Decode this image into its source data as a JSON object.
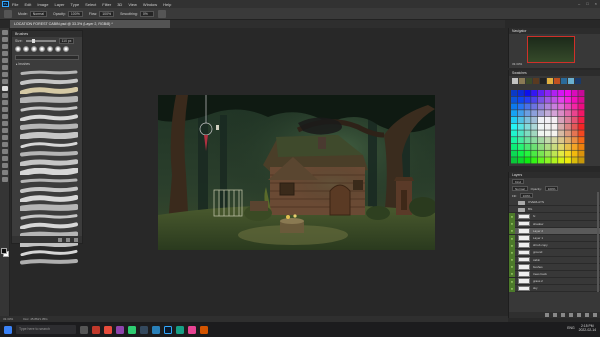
{
  "menubar": {
    "logo": "Ps",
    "items": [
      "File",
      "Edit",
      "Image",
      "Layer",
      "Type",
      "Select",
      "Filter",
      "3D",
      "View",
      "Window",
      "Help"
    ],
    "window_controls": [
      "–",
      "□",
      "×"
    ]
  },
  "options": {
    "mode_label": "Mode:",
    "mode_value": "Normal",
    "opacity_label": "Opacity:",
    "opacity_value": "100%",
    "flow_label": "Flow:",
    "flow_value": "100%",
    "smoothing_label": "Smoothing:",
    "smoothing_value": "0%"
  },
  "document": {
    "tab_title": "LOCATION FOREST CABIN.psd @ 33.3% (Layer 2, RGB/8) *"
  },
  "brushes_panel": {
    "title": "Brushes",
    "size_label": "Size:",
    "size_value": "110 px",
    "folder_name": "▸ brushes"
  },
  "navigator": {
    "title": "Navigator",
    "zoom": "33.33%"
  },
  "swatches": {
    "title": "Swatches",
    "colors": [
      "#c3c3c3",
      "#8a7a55",
      "#3c4a2a",
      "#5a3a20",
      "#222222",
      "#e2b040",
      "#c05020",
      "#2a6a9a",
      "#6ab0d0",
      "#1a3a6a"
    ]
  },
  "layers_panel": {
    "title": "Layers",
    "kind_label": "Kind",
    "blend_value": "Normal",
    "opacity_label": "Opacity:",
    "opacity_value": "100%",
    "fill_label": "Fill:",
    "fill_value": "100%",
    "layers": [
      {
        "name": "OVERLAYS",
        "type": "folder",
        "visible": false,
        "selected": false
      },
      {
        "name": "BG",
        "type": "folder",
        "visible": false,
        "selected": false
      },
      {
        "name": "fx",
        "type": "layer",
        "visible": true,
        "selected": false
      },
      {
        "name": "shadow",
        "type": "layer",
        "visible": true,
        "selected": false
      },
      {
        "name": "Layer 2",
        "type": "layer",
        "visible": true,
        "selected": true
      },
      {
        "name": "Layer 1",
        "type": "layer",
        "visible": true,
        "selected": false
      },
      {
        "name": "shrub copy",
        "type": "layer",
        "visible": true,
        "selected": false
      },
      {
        "name": "ground",
        "type": "layer",
        "visible": true,
        "selected": false
      },
      {
        "name": "cabin",
        "type": "layer",
        "visible": true,
        "selected": false
      },
      {
        "name": "bushes",
        "type": "layer",
        "visible": true,
        "selected": false
      },
      {
        "name": "trees back",
        "type": "layer",
        "visible": true,
        "selected": false
      },
      {
        "name": "grass 2",
        "type": "layer",
        "visible": true,
        "selected": false
      },
      {
        "name": "sky",
        "type": "layer",
        "visible": true,
        "selected": false
      }
    ]
  },
  "statusbar": {
    "zoom": "33.33%",
    "doc": "Doc: 45.8M/1.35G"
  },
  "taskbar": {
    "search_placeholder": "Type here to search",
    "lang": "ENG",
    "time": "2:15 PM",
    "date": "2022-02-14"
  }
}
